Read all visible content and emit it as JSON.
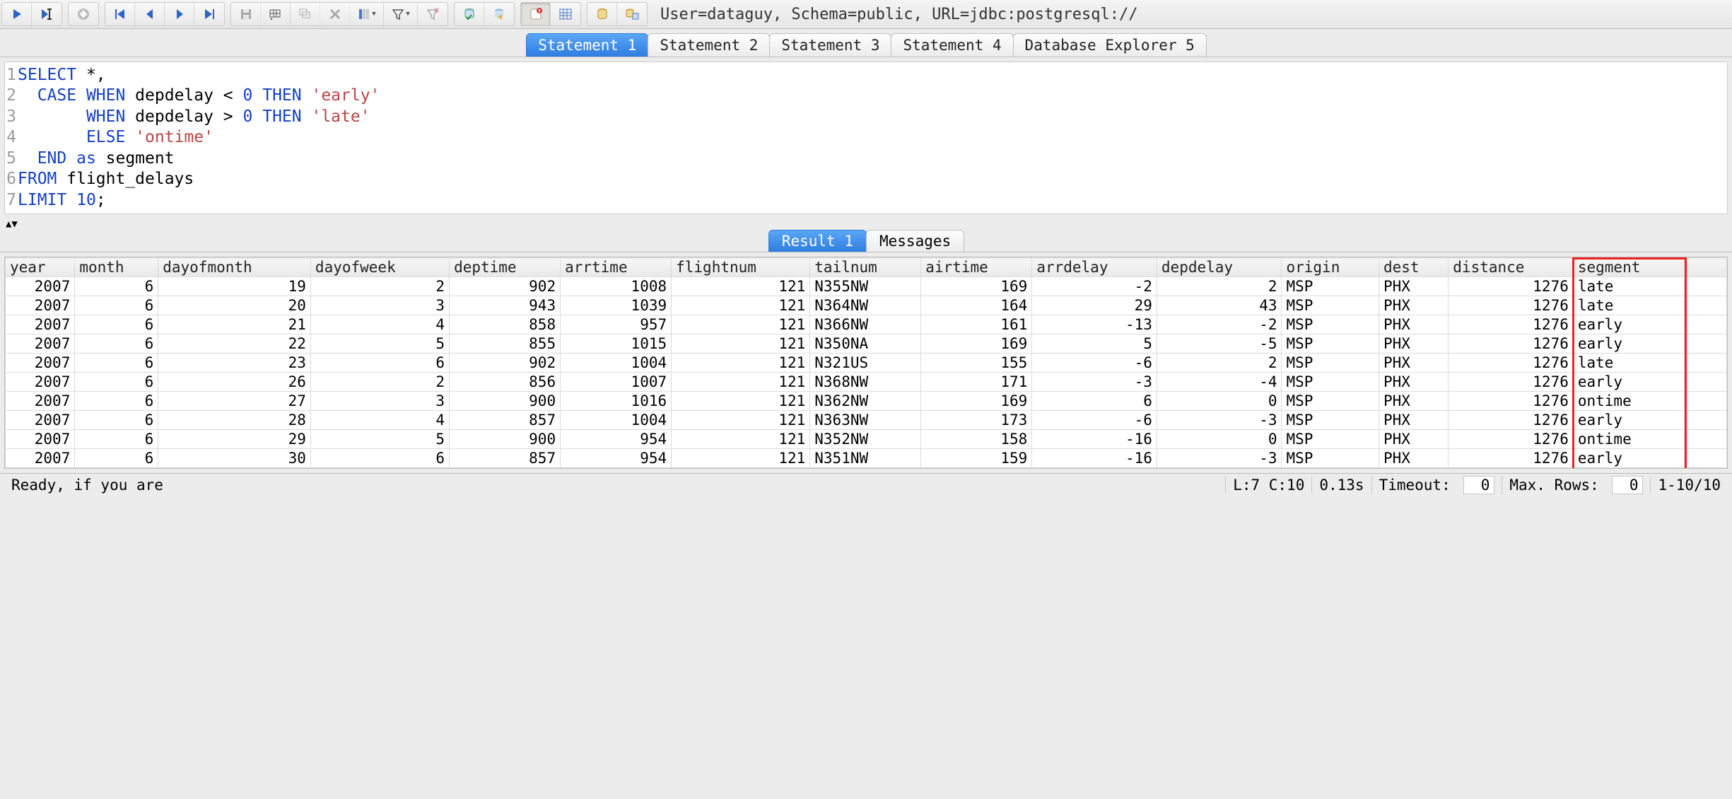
{
  "connection_info": "User=dataguy, Schema=public, URL=jdbc:postgresql://",
  "statement_tabs": [
    {
      "label": "Statement 1",
      "selected": true
    },
    {
      "label": "Statement 2",
      "selected": false
    },
    {
      "label": "Statement 3",
      "selected": false
    },
    {
      "label": "Statement 4",
      "selected": false
    },
    {
      "label": "Database Explorer 5",
      "selected": false
    }
  ],
  "sql": {
    "lines": [
      {
        "n": "1",
        "tokens": [
          {
            "t": "SELECT",
            "c": "kw"
          },
          {
            "t": " *,",
            "c": ""
          }
        ]
      },
      {
        "n": "2",
        "tokens": [
          {
            "t": "  ",
            "c": ""
          },
          {
            "t": "CASE WHEN",
            "c": "kw"
          },
          {
            "t": " depdelay < ",
            "c": ""
          },
          {
            "t": "0",
            "c": "num-lit"
          },
          {
            "t": " ",
            "c": ""
          },
          {
            "t": "THEN",
            "c": "kw"
          },
          {
            "t": " ",
            "c": ""
          },
          {
            "t": "'early'",
            "c": "str"
          }
        ]
      },
      {
        "n": "3",
        "tokens": [
          {
            "t": "       ",
            "c": ""
          },
          {
            "t": "WHEN",
            "c": "kw"
          },
          {
            "t": " depdelay > ",
            "c": ""
          },
          {
            "t": "0",
            "c": "num-lit"
          },
          {
            "t": " ",
            "c": ""
          },
          {
            "t": "THEN",
            "c": "kw"
          },
          {
            "t": " ",
            "c": ""
          },
          {
            "t": "'late'",
            "c": "str"
          }
        ]
      },
      {
        "n": "4",
        "tokens": [
          {
            "t": "       ",
            "c": ""
          },
          {
            "t": "ELSE",
            "c": "kw"
          },
          {
            "t": " ",
            "c": ""
          },
          {
            "t": "'ontime'",
            "c": "str"
          }
        ]
      },
      {
        "n": "5",
        "tokens": [
          {
            "t": "  ",
            "c": ""
          },
          {
            "t": "END as",
            "c": "kw"
          },
          {
            "t": " segment",
            "c": ""
          }
        ]
      },
      {
        "n": "6",
        "tokens": [
          {
            "t": "FROM",
            "c": "kw"
          },
          {
            "t": " flight_delays",
            "c": ""
          }
        ]
      },
      {
        "n": "7",
        "tokens": [
          {
            "t": "LIMIT",
            "c": "kw"
          },
          {
            "t": " ",
            "c": ""
          },
          {
            "t": "10",
            "c": "num-lit"
          },
          {
            "t": ";",
            "c": ""
          }
        ]
      }
    ]
  },
  "result_tabs": [
    {
      "label": "Result 1",
      "selected": true
    },
    {
      "label": "Messages",
      "selected": false
    }
  ],
  "grid": {
    "columns": [
      {
        "name": "year",
        "align": "num"
      },
      {
        "name": "month",
        "align": "num"
      },
      {
        "name": "dayofmonth",
        "align": "num"
      },
      {
        "name": "dayofweek",
        "align": "num"
      },
      {
        "name": "deptime",
        "align": "num"
      },
      {
        "name": "arrtime",
        "align": "num"
      },
      {
        "name": "flightnum",
        "align": "num"
      },
      {
        "name": "tailnum",
        "align": "txt"
      },
      {
        "name": "airtime",
        "align": "num"
      },
      {
        "name": "arrdelay",
        "align": "num"
      },
      {
        "name": "depdelay",
        "align": "num"
      },
      {
        "name": "origin",
        "align": "txt"
      },
      {
        "name": "dest",
        "align": "txt"
      },
      {
        "name": "distance",
        "align": "num"
      },
      {
        "name": "segment",
        "align": "txt",
        "highlight": true
      }
    ],
    "rows": [
      [
        "2007",
        "6",
        "19",
        "2",
        "902",
        "1008",
        "121",
        "N355NW",
        "169",
        "-2",
        "2",
        "MSP",
        "PHX",
        "1276",
        "late"
      ],
      [
        "2007",
        "6",
        "20",
        "3",
        "943",
        "1039",
        "121",
        "N364NW",
        "164",
        "29",
        "43",
        "MSP",
        "PHX",
        "1276",
        "late"
      ],
      [
        "2007",
        "6",
        "21",
        "4",
        "858",
        "957",
        "121",
        "N366NW",
        "161",
        "-13",
        "-2",
        "MSP",
        "PHX",
        "1276",
        "early"
      ],
      [
        "2007",
        "6",
        "22",
        "5",
        "855",
        "1015",
        "121",
        "N350NA",
        "169",
        "5",
        "-5",
        "MSP",
        "PHX",
        "1276",
        "early"
      ],
      [
        "2007",
        "6",
        "23",
        "6",
        "902",
        "1004",
        "121",
        "N321US",
        "155",
        "-6",
        "2",
        "MSP",
        "PHX",
        "1276",
        "late"
      ],
      [
        "2007",
        "6",
        "26",
        "2",
        "856",
        "1007",
        "121",
        "N368NW",
        "171",
        "-3",
        "-4",
        "MSP",
        "PHX",
        "1276",
        "early"
      ],
      [
        "2007",
        "6",
        "27",
        "3",
        "900",
        "1016",
        "121",
        "N362NW",
        "169",
        "6",
        "0",
        "MSP",
        "PHX",
        "1276",
        "ontime"
      ],
      [
        "2007",
        "6",
        "28",
        "4",
        "857",
        "1004",
        "121",
        "N363NW",
        "173",
        "-6",
        "-3",
        "MSP",
        "PHX",
        "1276",
        "early"
      ],
      [
        "2007",
        "6",
        "29",
        "5",
        "900",
        "954",
        "121",
        "N352NW",
        "158",
        "-16",
        "0",
        "MSP",
        "PHX",
        "1276",
        "ontime"
      ],
      [
        "2007",
        "6",
        "30",
        "6",
        "857",
        "954",
        "121",
        "N351NW",
        "159",
        "-16",
        "-3",
        "MSP",
        "PHX",
        "1276",
        "early"
      ]
    ]
  },
  "status": {
    "ready": "Ready, if you are",
    "cursor": "L:7 C:10",
    "elapsed": "0.13s",
    "timeout_label": "Timeout:",
    "timeout_value": "0",
    "maxrows_label": "Max. Rows:",
    "maxrows_value": "0",
    "range": "1-10/10"
  }
}
